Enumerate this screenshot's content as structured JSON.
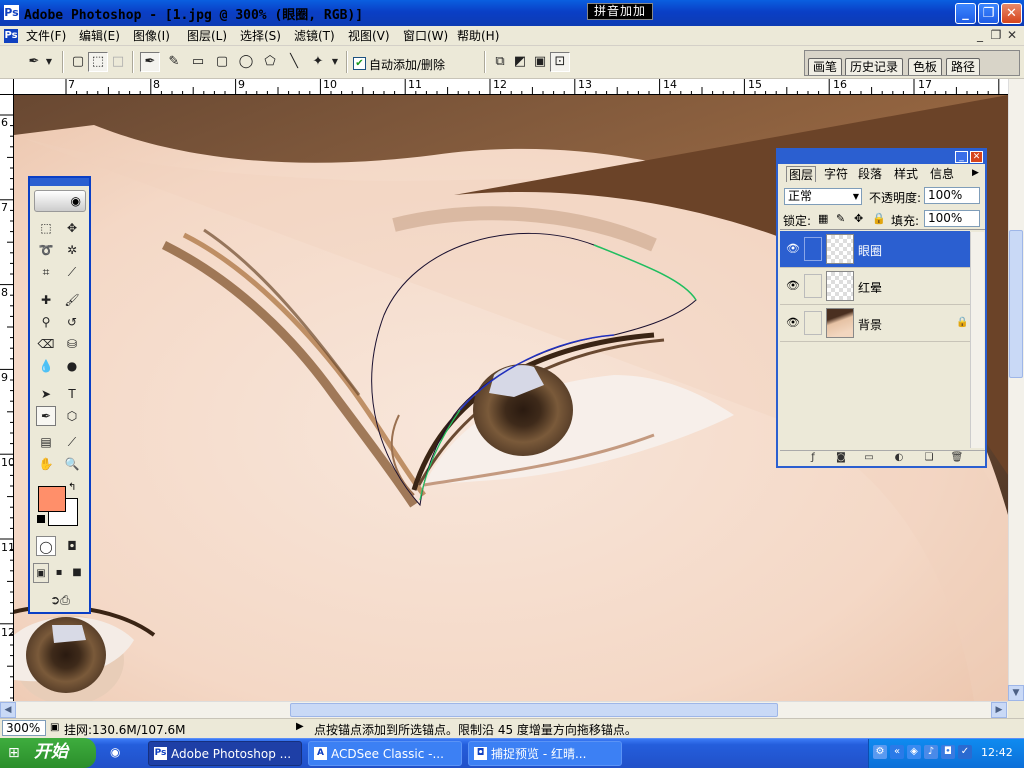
{
  "window": {
    "title": "Adobe Photoshop - [1.jpg @ 300% (眼圈, RGB)]",
    "ime": "拼音加加",
    "minimize_glyph": "_",
    "maximize_glyph": "❐",
    "close_glyph": "✕"
  },
  "menu": {
    "items": [
      "文件(F)",
      "编辑(E)",
      "图像(I)",
      "图层(L)",
      "选择(S)",
      "滤镜(T)",
      "视图(V)",
      "窗口(W)",
      "帮助(H)"
    ],
    "doc_min": "_",
    "doc_restore": "❐",
    "doc_close": "✕"
  },
  "options": {
    "auto_add_delete_label": "自动添加/删除",
    "auto_add_delete_checked": true,
    "palette_tabs": [
      "画笔",
      "历史记录",
      "色板",
      "路径"
    ]
  },
  "rulers": {
    "h_ticks": [
      "7",
      "8",
      "9",
      "10",
      "11",
      "12",
      "13",
      "14",
      "15",
      "16",
      "17"
    ],
    "v_ticks": [
      "6",
      "7",
      "8",
      "9",
      "10",
      "11",
      "12"
    ]
  },
  "toolbox": {
    "foreground_color": "#ff8f6a",
    "background_color": "#ffffff"
  },
  "layers_panel": {
    "tabs": [
      "图层",
      "字符",
      "段落",
      "样式",
      "信息"
    ],
    "blend_mode": "正常",
    "opacity_label": "不透明度:",
    "opacity_value": "100%",
    "lock_label": "锁定:",
    "fill_label": "填充:",
    "fill_value": "100%",
    "layers": [
      {
        "name": "眼圈",
        "selected": true
      },
      {
        "name": "红晕",
        "selected": false
      },
      {
        "name": "背景",
        "selected": false,
        "locked": true
      }
    ]
  },
  "status": {
    "zoom": "300%",
    "doc_info": "挂网:130.6M/107.6M",
    "hint": "点按锚点添加到所选锚点。限制沿 45 度增量方向拖移锚点。"
  },
  "taskbar": {
    "start_label": "开始",
    "tasks": [
      "Adobe Photoshop ...",
      "ACDSee Classic -...",
      "捕捉预览 - 红晴..."
    ],
    "clock": "12:42"
  }
}
